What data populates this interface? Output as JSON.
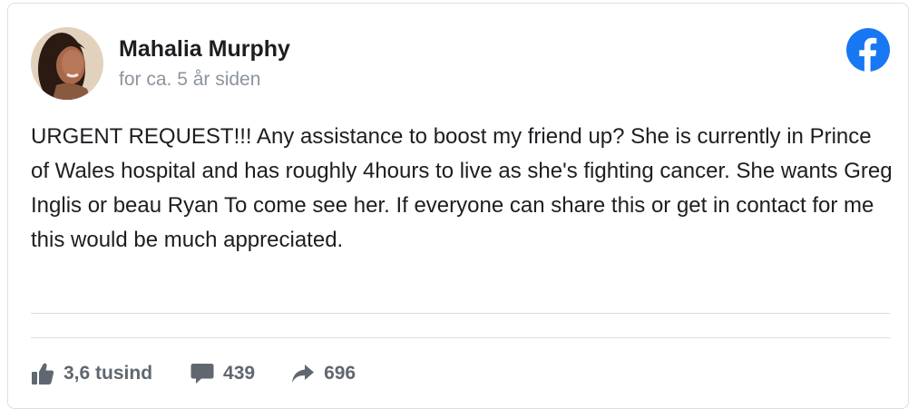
{
  "post": {
    "author": "Mahalia Murphy",
    "timestamp": "for ca. 5 år siden",
    "text": "URGENT REQUEST!!! Any assistance to boost my friend up? She is currently in Prince of Wales hospital and has roughly 4hours to live as she's fighting cancer. She wants Greg Inglis or beau Ryan To come see her. If everyone can share this or get in contact for me this would be much appreciated."
  },
  "stats": {
    "likes": "3,6 tusind",
    "comments": "439",
    "shares": "696"
  },
  "icons": {
    "brand": "facebook-logo-icon",
    "likes": "thumbs-up-icon",
    "comments": "comment-bubble-icon",
    "shares": "share-arrow-icon"
  },
  "colors": {
    "facebook_blue": "#1877f2",
    "name_text": "#1c1e21",
    "muted_text": "#8d949e",
    "stat_text": "#606770"
  }
}
